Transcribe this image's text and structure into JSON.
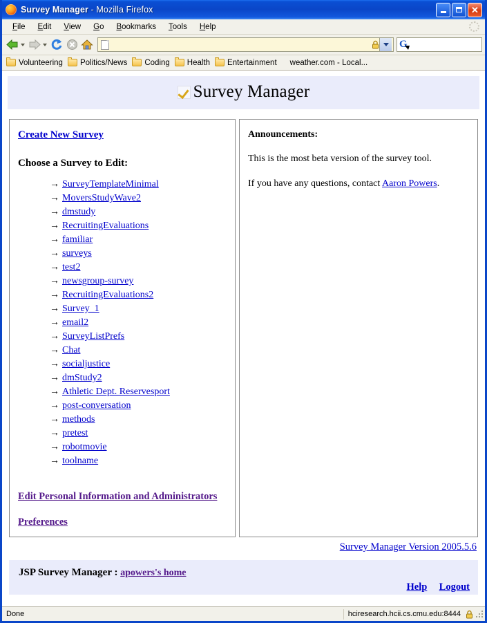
{
  "window": {
    "title_app": "Survey Manager",
    "title_sep": " - ",
    "title_browser": "Mozilla Firefox",
    "minimize_label": "Minimize",
    "maximize_label": "Maximize",
    "close_label": "Close"
  },
  "menu": {
    "items": [
      {
        "pre": "",
        "key": "F",
        "post": "ile"
      },
      {
        "pre": "",
        "key": "E",
        "post": "dit"
      },
      {
        "pre": "",
        "key": "V",
        "post": "iew"
      },
      {
        "pre": "",
        "key": "G",
        "post": "o"
      },
      {
        "pre": "",
        "key": "B",
        "post": "ookmarks"
      },
      {
        "pre": "",
        "key": "T",
        "post": "ools"
      },
      {
        "pre": "",
        "key": "H",
        "post": "elp"
      }
    ]
  },
  "toolbar": {
    "back_icon": "back-arrow-icon",
    "forward_icon": "forward-arrow-icon",
    "reload_icon": "reload-icon",
    "stop_icon": "stop-icon",
    "home_icon": "home-icon",
    "url_value": "",
    "url_placeholder": "",
    "search_value": "",
    "search_placeholder": "",
    "search_engine_icon": "google-g-icon",
    "lock_icon": "padlock-icon"
  },
  "bookmarks": {
    "folders": [
      "Volunteering",
      "Politics/News",
      "Coding",
      "Health",
      "Entertainment"
    ],
    "links": [
      "weather.com - Local..."
    ]
  },
  "page": {
    "banner": {
      "icon": "gold-checkmark-icon",
      "title": "Survey Manager"
    },
    "left_panel": {
      "create_link": "Create New Survey",
      "choose_heading": "Choose a Survey to Edit:",
      "arrow_glyph": "→",
      "surveys": [
        "SurveyTemplateMinimal",
        "MoversStudyWave2",
        "dmstudy",
        "RecruitingEvaluations",
        "familiar",
        "surveys",
        "test2",
        "newsgroup-survey",
        "RecruitingEvaluations2",
        "Survey_1",
        "email2",
        "SurveyListPrefs",
        "Chat",
        "socialjustice",
        "dmStudy2",
        "Athletic Dept. Reservesport",
        "post-conversation",
        "methods",
        "pretest",
        "robotmovie",
        "toolname"
      ],
      "edit_personal_link": "Edit Personal Information and Administrators",
      "preferences_link": "Preferences"
    },
    "right_panel": {
      "heading": "Announcements:",
      "paragraph1": "This is the most beta version of the survey tool.",
      "paragraph2_pre": "If you have any questions, contact ",
      "paragraph2_link": "Aaron Powers",
      "paragraph2_post": "."
    },
    "version_link": "Survey Manager Version 2005.5.6",
    "footer": {
      "label": "JSP Survey Manager : ",
      "user_home_link": "apowers's home",
      "help_link": "Help",
      "logout_link": "Logout"
    }
  },
  "statusbar": {
    "status_text": "Done",
    "host_text": "hciresearch.hcii.cs.cmu.edu:8444",
    "lock_icon": "padlock-icon"
  },
  "colors": {
    "titlebar": "#0a46c8",
    "banner_bg": "#eaecfb",
    "link": "#0000cc",
    "visited_link": "#551a8b",
    "chrome_bg": "#f2f1ea",
    "urlbar_bg": "#fcf7d8"
  }
}
